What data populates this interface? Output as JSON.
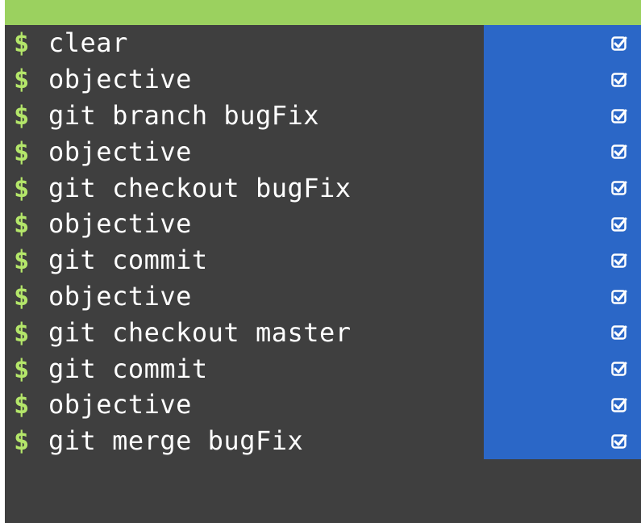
{
  "terminal": {
    "prompt": "$",
    "commands": [
      "clear",
      "objective",
      "git branch bugFix",
      "objective",
      "git checkout bugFix",
      "objective",
      "git commit",
      "objective",
      "git checkout master",
      "git commit",
      "objective",
      "git merge bugFix"
    ],
    "status_icon": "checkbox-checked-icon"
  },
  "colors": {
    "top_bar": "#9bd15f",
    "terminal_bg": "#3f3f3f",
    "prompt": "#b4e66a",
    "text": "#ffffff",
    "highlight": "#2b67c7"
  }
}
